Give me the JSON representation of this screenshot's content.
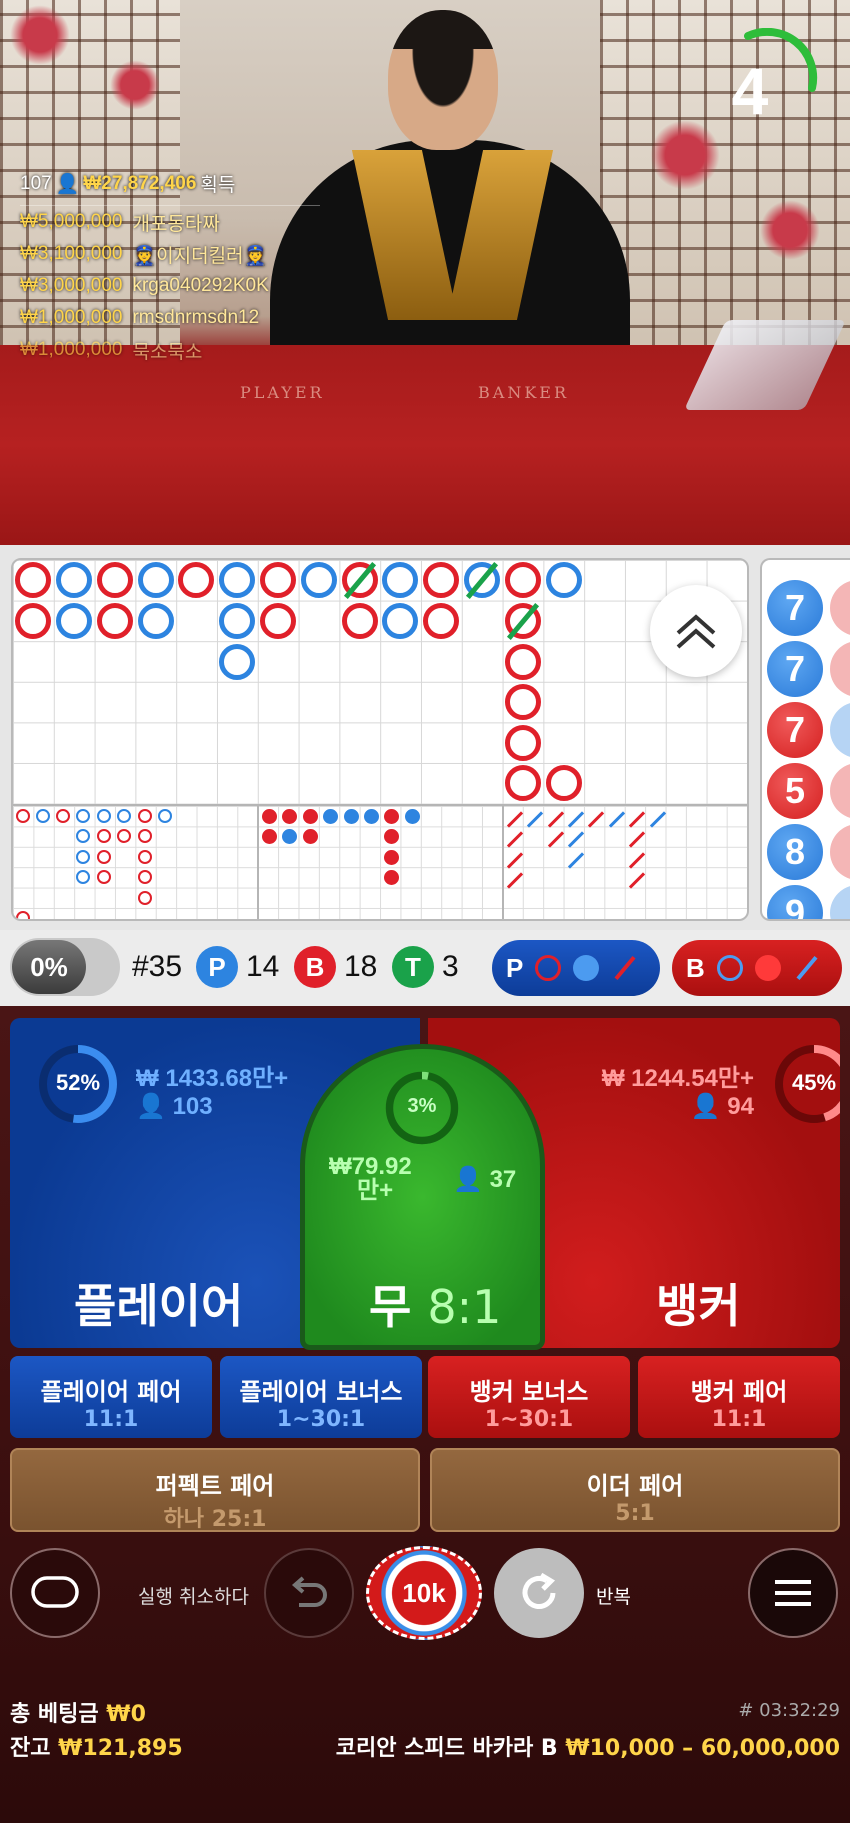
{
  "video": {
    "countdown": "4",
    "table_words": [
      "PLAYER",
      "BANKER"
    ],
    "winners_header": {
      "count": "107",
      "amount": "₩27,872,406",
      "suffix": "획득"
    },
    "winners": [
      {
        "amount": "₩5,000,000",
        "name": "개포동타짜"
      },
      {
        "amount": "₩3,100,000",
        "name": "👮이지더킬러👮"
      },
      {
        "amount": "₩3,000,000",
        "name": "krga040292K0K"
      },
      {
        "amount": "₩1,000,000",
        "name": "rmsdnrmsdn12"
      },
      {
        "amount": "₩1,000,000",
        "name": "묵소묵소"
      }
    ]
  },
  "stats": {
    "progress_pct": "0%",
    "round": "#35",
    "player_letter": "P",
    "player_count": "14",
    "banker_letter": "B",
    "banker_count": "18",
    "tie_letter": "T",
    "tie_count": "3",
    "predict_player": "P",
    "predict_banker": "B"
  },
  "beads": [
    "7",
    "7",
    "7",
    "5",
    "8",
    "9"
  ],
  "bets": {
    "player": {
      "title": "플레이어",
      "pct": "52%",
      "amount": "₩ 1433.68만+",
      "players": "103",
      "pct_value": 52
    },
    "banker": {
      "title": "뱅커",
      "pct": "45%",
      "amount": "₩ 1244.54만+",
      "players": "94",
      "pct_value": 45
    },
    "tie": {
      "title": "무",
      "odds": "8:1",
      "pct": "3%",
      "amount_top": "₩79.92",
      "amount_bottom": "만+",
      "players": "37",
      "pct_value": 3
    },
    "side": [
      {
        "title": "플레이어 페어",
        "odds": "11:1"
      },
      {
        "title": "플레이어 보너스",
        "odds": "1~30:1"
      },
      {
        "title": "뱅커 보너스",
        "odds": "1~30:1"
      },
      {
        "title": "뱅커 페어",
        "odds": "11:1"
      },
      {
        "title": "퍼펙트 페어",
        "odds": "하나 25:1"
      },
      {
        "title": "이더 페어",
        "odds": "5:1"
      }
    ]
  },
  "controls": {
    "undo_label": "실행 취소하다",
    "chip_value": "10k",
    "repeat_label": "반복"
  },
  "footer": {
    "total_bet_label": "총 베팅금",
    "total_bet_value": "₩0",
    "balance_label": "잔고",
    "balance_value": "₩121,895",
    "game_id": "# 03:32:29",
    "table_name": "코리안 스피드 바카라 B",
    "limits": "₩10,000 – 60,000,000"
  },
  "colors": {
    "player": "#1c57c4",
    "banker": "#d11d1d",
    "tie": "#2aa52a",
    "gold": "#ffd54a"
  }
}
